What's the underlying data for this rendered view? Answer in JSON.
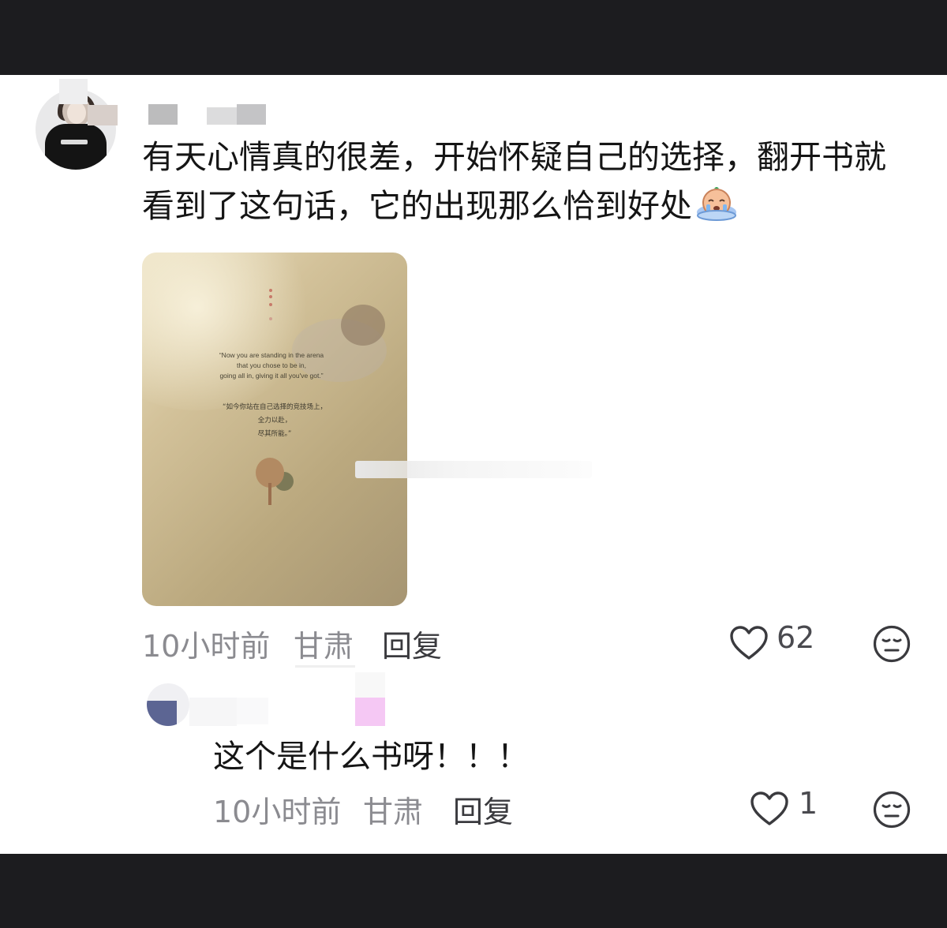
{
  "comment": {
    "text": "有天心情真的很差，开始怀疑自己的选择，翻开书就看到了这句话，它的出现那么恰到好处",
    "emoji": "crying-face-icon",
    "image": {
      "quote_en_line1": "“Now you are standing in the arena",
      "quote_en_line2": "that you chose to be in,",
      "quote_en_line3": "going all in, giving it all you've got.”",
      "quote_zh_line1": "“如今你站在自己选择的竞技场上，",
      "quote_zh_line2": "全力以赴，",
      "quote_zh_line3": "尽其所能。”"
    },
    "time": "10小时前",
    "location": "甘肃",
    "reply_label": "回复",
    "likes": "62"
  },
  "reply": {
    "text": "这个是什么书呀！！！",
    "time": "10小时前",
    "location": "甘肃",
    "reply_label": "回复",
    "likes": "1"
  }
}
